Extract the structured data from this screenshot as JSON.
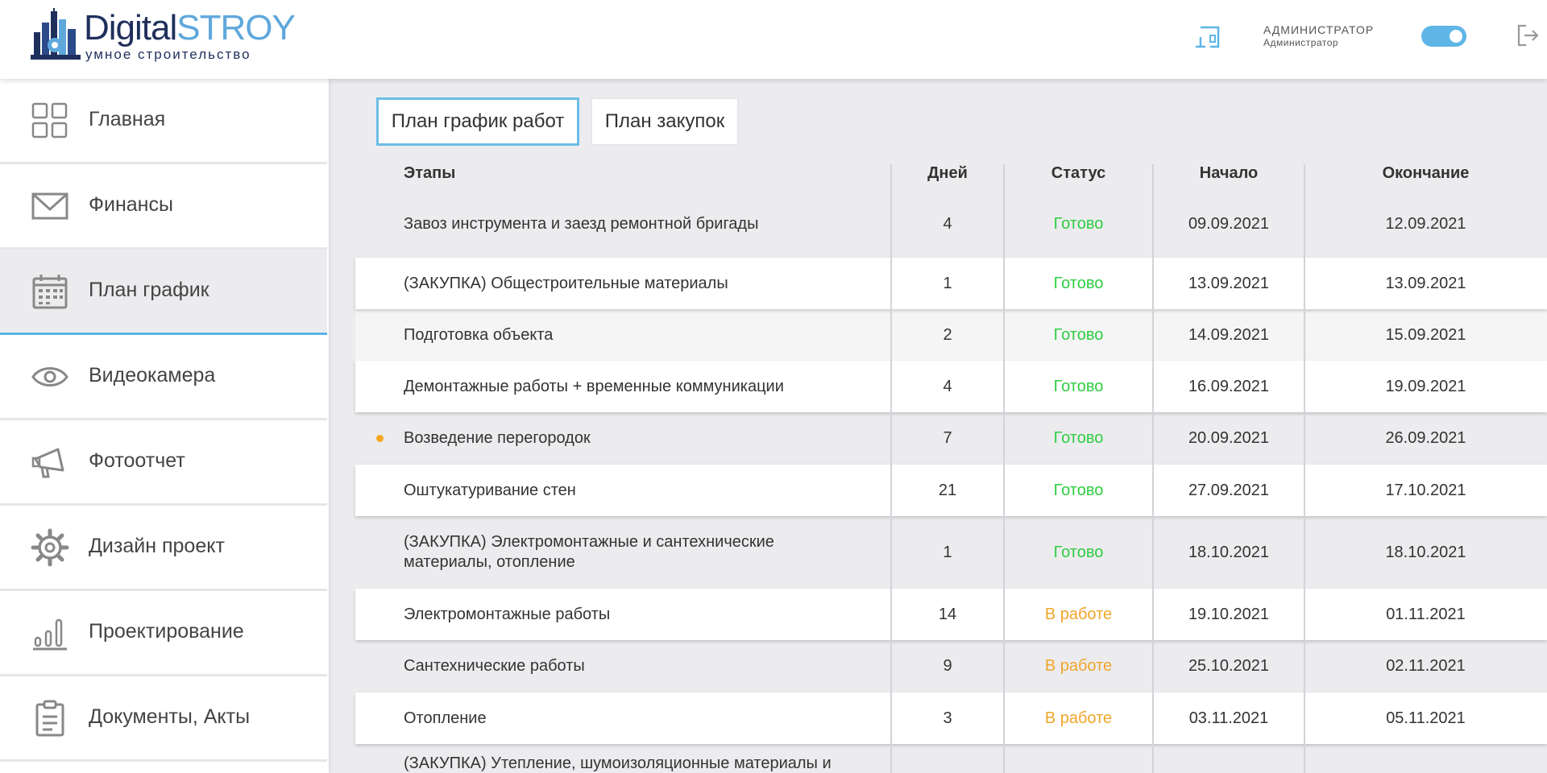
{
  "header": {
    "logo_word1": "Digital",
    "logo_word2": "STROY",
    "logo_subtitle": "умное строительство",
    "user_role": "АДМИНИСТРАТОР",
    "user_name": "Администратор",
    "toggle_on": true
  },
  "sidebar": {
    "items": [
      {
        "label": "Главная",
        "icon": "grid-icon"
      },
      {
        "label": "Финансы",
        "icon": "envelope-icon"
      },
      {
        "label": "План график",
        "icon": "calendar-icon",
        "active": true
      },
      {
        "label": "Видеокамера",
        "icon": "eye-icon"
      },
      {
        "label": "Фотоотчет",
        "icon": "megaphone-icon"
      },
      {
        "label": "Дизайн проект",
        "icon": "gear-icon"
      },
      {
        "label": "Проектирование",
        "icon": "bar-chart-icon"
      },
      {
        "label": "Документы, Акты",
        "icon": "clipboard-icon"
      }
    ]
  },
  "tabs": [
    {
      "label": "План график работ",
      "active": true
    },
    {
      "label": "План закупок",
      "active": false
    }
  ],
  "table": {
    "headers": {
      "stages": "Этапы",
      "days": "Дней",
      "status": "Статус",
      "start": "Начало",
      "end": "Окончание"
    },
    "rows": [
      {
        "name": "Завоз инструмента и заезд ремонтной бригады",
        "days": "4",
        "status": "Готово",
        "start": "09.09.2021",
        "end": "12.09.2021"
      },
      {
        "name": "(ЗАКУПКА) Общестроительные материалы",
        "days": "1",
        "status": "Готово",
        "start": "13.09.2021",
        "end": "13.09.2021"
      },
      {
        "name": "Подготовка объекта",
        "days": "2",
        "status": "Готово",
        "start": "14.09.2021",
        "end": "15.09.2021"
      },
      {
        "name": "Демонтажные работы + временные коммуникации",
        "days": "4",
        "status": "Готово",
        "start": "16.09.2021",
        "end": "19.09.2021"
      },
      {
        "name": "Возведение перегородок",
        "days": "7",
        "status": "Готово",
        "start": "20.09.2021",
        "end": "26.09.2021",
        "marker": true
      },
      {
        "name": "Оштукатуривание стен",
        "days": "21",
        "status": "Готово",
        "start": "27.09.2021",
        "end": "17.10.2021"
      },
      {
        "name": "(ЗАКУПКА) Электромонтажные и сантехнические материалы, отопление",
        "days": "1",
        "status": "Готово",
        "start": "18.10.2021",
        "end": "18.10.2021"
      },
      {
        "name": "Электромонтажные работы",
        "days": "14",
        "status": "В работе",
        "start": "19.10.2021",
        "end": "01.11.2021"
      },
      {
        "name": "Сантехнические работы",
        "days": "9",
        "status": "В работе",
        "start": "25.10.2021",
        "end": "02.11.2021"
      },
      {
        "name": "Отопление",
        "days": "3",
        "status": "В работе",
        "start": "03.11.2021",
        "end": "05.11.2021"
      },
      {
        "name": "(ЗАКУПКА) Утепление, шумоизоляционные материалы и",
        "days": "",
        "status": "",
        "start": "",
        "end": ""
      }
    ]
  },
  "colors": {
    "accent": "#5ab4e5",
    "status_done": "#2ecc40",
    "status_in_progress": "#f0a52a",
    "marker": "#f5a623"
  }
}
